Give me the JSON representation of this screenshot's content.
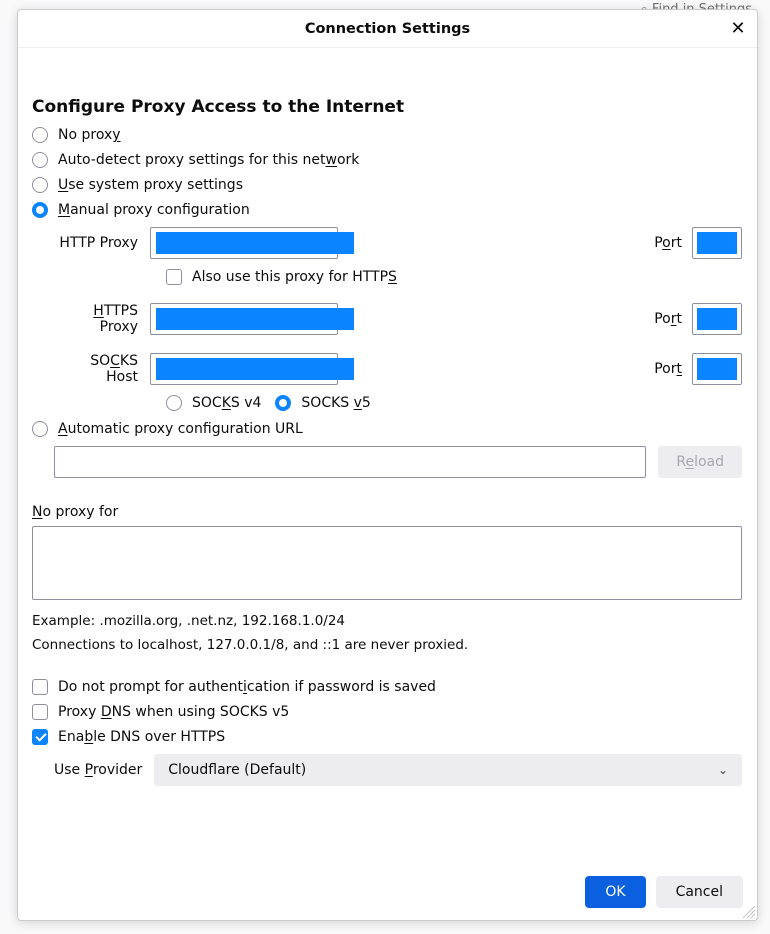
{
  "dialog": {
    "title": "Connection Settings",
    "heading": "Configure Proxy Access to the Internet",
    "close_glyph": "✕"
  },
  "radios": {
    "no_proxy": {
      "pre": "No prox",
      "u": "y",
      "post": ""
    },
    "auto_detect": {
      "pre": "Auto-detect proxy settings for this net",
      "u": "w",
      "post": "ork"
    },
    "system": {
      "pre": "",
      "u": "U",
      "post": "se system proxy settings"
    },
    "manual": {
      "pre": "",
      "u": "M",
      "post": "anual proxy configuration"
    },
    "auto_url": {
      "pre": "",
      "u": "A",
      "post": "utomatic proxy configuration URL"
    }
  },
  "proxy": {
    "http_label": "HTTP Proxy",
    "https_label_pre": "",
    "https_label_u": "H",
    "https_label_post": "TTPS Proxy",
    "socks_label_pre": "SO",
    "socks_label_u": "C",
    "socks_label_post": "KS Host",
    "port_label_pre": "P",
    "port_label_u": "o",
    "port_label_post": "rt",
    "port2_label_pre": "Po",
    "port2_label_u": "r",
    "port2_label_post": "t",
    "port3_label_pre": "Por",
    "port3_label_u": "t",
    "port3_label_post": "",
    "also_https": {
      "pre": "Also use this proxy for HTTP",
      "u": "S",
      "post": ""
    },
    "socks_v4": {
      "pre": "SOC",
      "u": "K",
      "post": "S v4"
    },
    "socks_v5": {
      "pre": "SOCKS ",
      "u": "v",
      "post": "5"
    }
  },
  "reload_label": {
    "pre": "R",
    "u": "e",
    "post": "load"
  },
  "no_proxy_for": {
    "pre": "",
    "u": "N",
    "post": "o proxy for"
  },
  "hints": {
    "example": "Example: .mozilla.org, .net.nz, 192.168.1.0/24",
    "localhost": "Connections to localhost, 127.0.0.1/8, and ::1 are never proxied."
  },
  "checks": {
    "no_prompt": {
      "pre": "Do not prompt for authent",
      "u": "i",
      "post": "cation if password is saved"
    },
    "proxy_dns": {
      "pre": "Proxy ",
      "u": "D",
      "post": "NS when using SOCKS v5"
    },
    "doh": {
      "pre": "Ena",
      "u": "b",
      "post": "le DNS over HTTPS"
    }
  },
  "provider": {
    "label_pre": "Use ",
    "label_u": "P",
    "label_post": "rovider",
    "value": "Cloudflare (Default)"
  },
  "buttons": {
    "ok": "OK",
    "cancel": "Cancel"
  },
  "background": {
    "search_placeholder": "Find in Settings"
  }
}
